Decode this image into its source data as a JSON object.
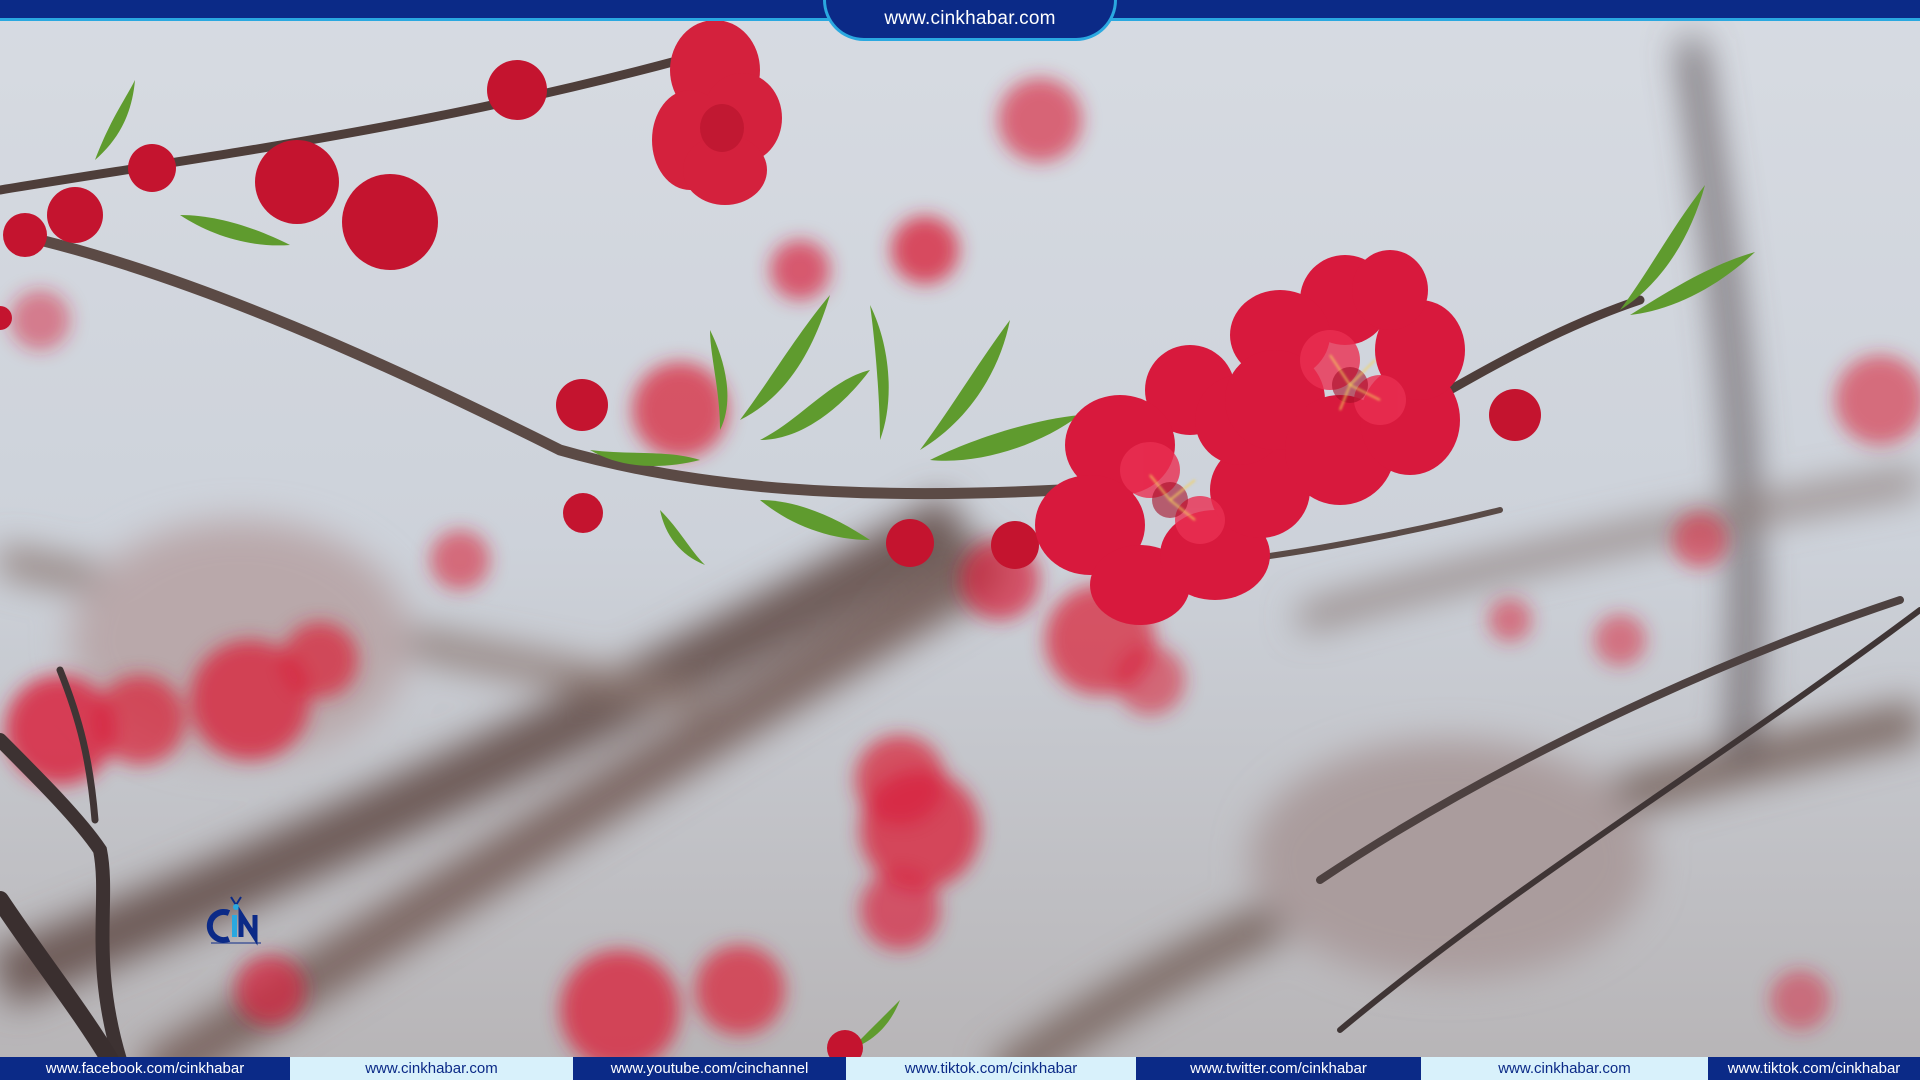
{
  "header": {
    "website": "www.cinkhabar.com"
  },
  "footer": {
    "links": [
      "www.facebook.com/cinkhabar",
      "www.cinkhabar.com",
      "www.youtube.com/cinchannel",
      "www.tiktok.com/cinkhabar",
      "www.twitter.com/cinkhabar",
      "www.cinkhabar.com",
      "www.tiktok.com/cinkhabar"
    ]
  },
  "colors": {
    "bar_dark": "#0b2a87",
    "bar_light": "#d8f1fb",
    "accent_line": "#2aa8e0",
    "blossom": "#d81e3f"
  },
  "logo": {
    "icon": "cin-logo-icon"
  }
}
